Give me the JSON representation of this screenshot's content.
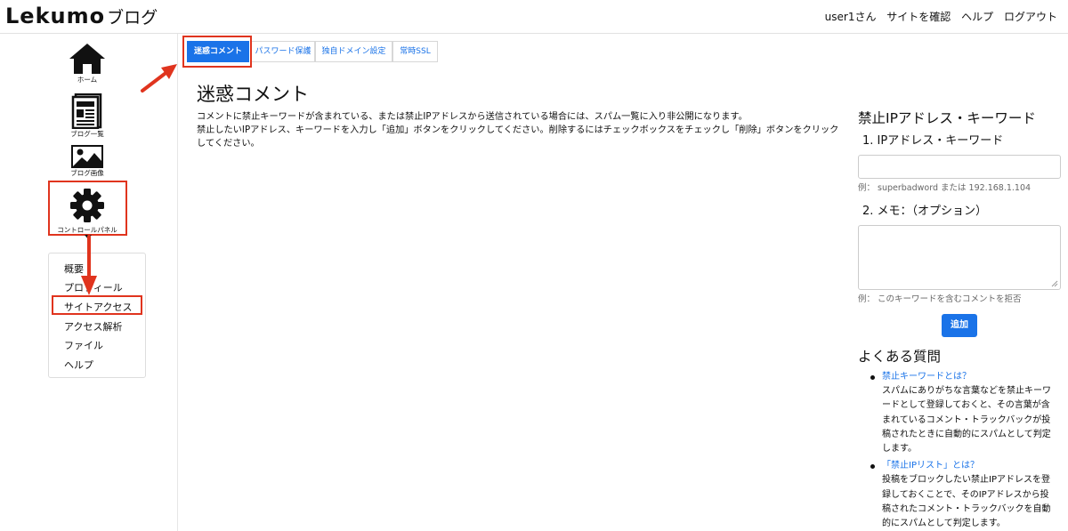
{
  "header": {
    "logo": "Lekumo",
    "logo_sub": "ブログ",
    "nav": [
      "user1さん",
      "サイトを確認",
      "ヘルプ",
      "ログアウト"
    ]
  },
  "sidebar": {
    "items": [
      {
        "label": "ホーム",
        "icon": "home-icon"
      },
      {
        "label": "ブログ一覧",
        "icon": "blog-list-icon"
      },
      {
        "label": "ブログ画像",
        "icon": "image-icon"
      },
      {
        "label": "コントロールパネル",
        "icon": "gear-icon"
      }
    ],
    "submenu": [
      "概要",
      "プロフィール",
      "サイトアクセス",
      "アクセス解析",
      "ファイル",
      "ヘルプ"
    ]
  },
  "tabs": [
    {
      "label": "迷惑コメント",
      "active": true
    },
    {
      "label": "パスワード保護",
      "active": false
    },
    {
      "label": "独自ドメイン設定",
      "active": false
    },
    {
      "label": "常時SSL",
      "active": false
    }
  ],
  "main": {
    "title": "迷惑コメント",
    "desc_1": "コメントに禁止キーワードが含まれている、または禁止IPアドレスから送信されている場合には、スパム一覧に入り非公開になります。",
    "desc_2": "禁止したいIPアドレス、キーワードを入力し「追加」ボタンをクリックしてください。削除するにはチェックボックスをチェックし「削除」ボタンをクリックしてください。"
  },
  "right": {
    "title": "禁止IPアドレス・キーワード",
    "label_1": "1. IPアドレス・キーワード",
    "hint_1": "例： superbadword または 192.168.1.104",
    "label_2": "2. メモ：（オプション）",
    "hint_2": "例： このキーワードを含むコメントを拒否",
    "add_button": "追加",
    "faq_title": "よくある質問",
    "faq": [
      {
        "q": "禁止キーワードとは？",
        "a": "スパムにありがちな言葉などを禁止キーワードとして登録しておくと、その言葉が含まれているコメント・トラックバックが投稿されたときに自動的にスパムとして判定します。"
      },
      {
        "q": "「禁止IPリスト」とは？",
        "a": "投稿をブロックしたい禁止IPアドレスを登録しておくことで、そのIPアドレスから投稿されたコメント・トラックバックを自動的にスパムとして判定します。"
      }
    ]
  },
  "colors": {
    "accent": "#1a73e8",
    "annotation_red": "#e0341e"
  }
}
